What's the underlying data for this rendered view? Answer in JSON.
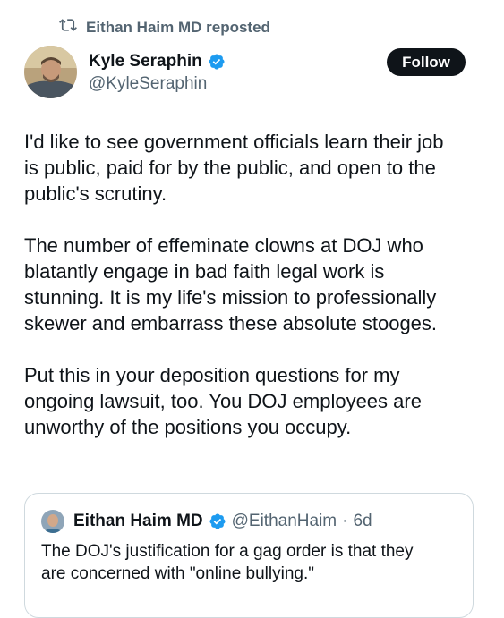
{
  "repost": {
    "label": "Eithan Haim MD reposted",
    "icon": "repost-icon",
    "color": "#536471"
  },
  "author": {
    "name": "Kyle Seraphin",
    "handle": "@KyleSeraphin",
    "verified": true,
    "verified_color": "#1d9bf0",
    "avatar": "avatar"
  },
  "follow_button": {
    "label": "Follow"
  },
  "tweet": {
    "paragraphs": [
      "I'd like to see government officials learn their job\nis public, paid for by the public, and open to the\npublic's scrutiny.",
      "The number of effeminate clowns at DOJ who\nblatantly engage in bad faith legal work is\nstunning. It is my life's mission to professionally\nskewer and embarrass these absolute stooges.",
      "Put this in your deposition questions for my\nongoing lawsuit, too. You DOJ employees are\nunworthy of the positions you occupy."
    ]
  },
  "quote": {
    "name": "Eithan Haim MD",
    "handle": "@EithanHaim",
    "separator": "·",
    "time": "6d",
    "verified": true,
    "text": "The DOJ's justification for a gag order is that they\nare concerned with \"online bullying.\""
  }
}
